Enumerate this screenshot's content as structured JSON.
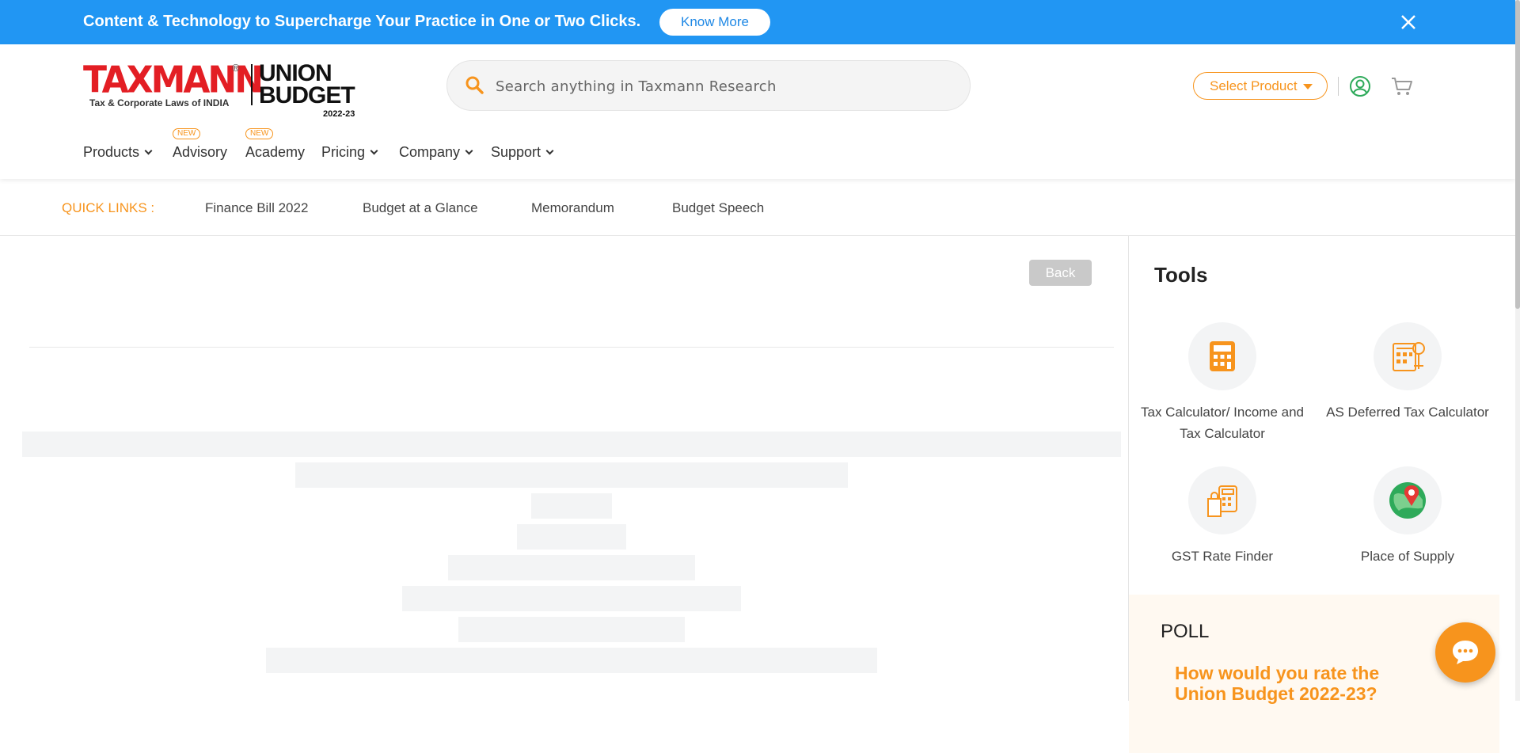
{
  "promo": {
    "message": "Content & Technology to Supercharge Your Practice in One or Two Clicks.",
    "cta": "Know More",
    "bg_color": "#2196f3"
  },
  "logo": {
    "brand": "TAXMANN",
    "registered": "®",
    "tagline": "Tax & Corporate Laws of INDIA",
    "union_line1": "UNION",
    "union_line2": "BUDGET",
    "year": "2022-23"
  },
  "search": {
    "placeholder": "Search anything in Taxmann Research",
    "icon": "search-icon"
  },
  "header_right": {
    "select_product": "Select Product",
    "user_icon": "user-icon",
    "cart_icon": "cart-icon"
  },
  "nav": {
    "products": "Products",
    "advisory": "Advisory",
    "academy": "Academy",
    "pricing": "Pricing",
    "company": "Company",
    "support": "Support",
    "new_badge": "NEW"
  },
  "quick_links": {
    "label": "QUICK LINKS :",
    "items": [
      "Finance Bill 2022",
      "Budget at a Glance",
      "Memorandum",
      "Budget Speech"
    ]
  },
  "main": {
    "back_label": "Back"
  },
  "tools": {
    "title": "Tools",
    "items": [
      {
        "label": "Tax Calculator/ Income and Tax Calculator",
        "icon": "calculator-icon"
      },
      {
        "label": "AS Deferred Tax Calculator",
        "icon": "deferred-tax-icon"
      },
      {
        "label": "GST Rate Finder",
        "icon": "gst-icon"
      },
      {
        "label": "Place of Supply",
        "icon": "map-pin-icon"
      }
    ]
  },
  "poll": {
    "heading": "POLL",
    "question": "How would you rate the Union Budget 2022-23?"
  },
  "colors": {
    "accent": "#f7941d",
    "brand_red": "#e31e24",
    "green": "#2eaa5a"
  }
}
